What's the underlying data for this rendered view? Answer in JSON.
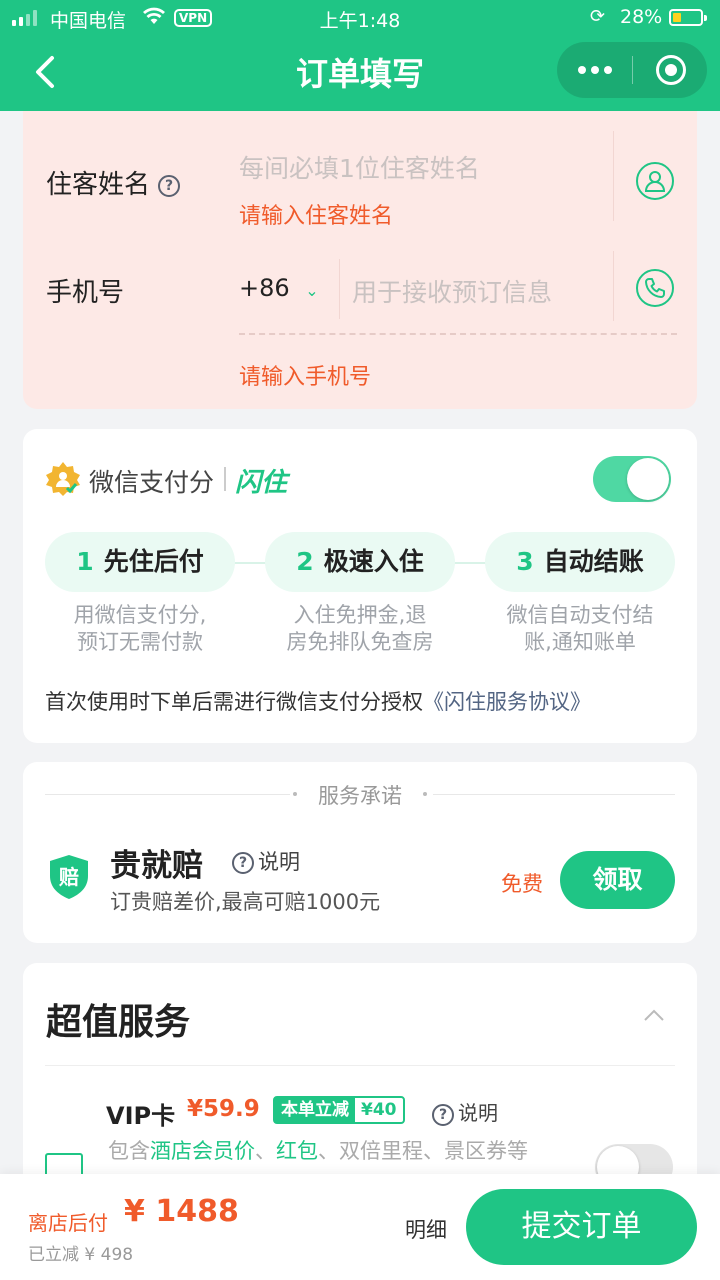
{
  "status_bar": {
    "carrier": "中国电信",
    "vpn": "VPN",
    "time": "上午1:48",
    "battery": "28%"
  },
  "header": {
    "title": "订单填写"
  },
  "guest_form": {
    "name_label": "住客姓名",
    "name_placeholder": "每间必填1位住客姓名",
    "name_error": "请输入住客姓名",
    "phone_label": "手机号",
    "country_code": "+86",
    "phone_placeholder": "用于接收预订信息",
    "phone_error": "请输入手机号"
  },
  "wechat_pay": {
    "brand": "微信支付分",
    "product": "闪住",
    "toggle_on": true,
    "steps": [
      {
        "num": "1",
        "label": "先住后付",
        "desc1": "用微信支付分,",
        "desc2": "预订无需付款"
      },
      {
        "num": "2",
        "label": "极速入住",
        "desc1": "入住免押金,退",
        "desc2": "房免排队免查房"
      },
      {
        "num": "3",
        "label": "自动结账",
        "desc1": "微信自动支付结",
        "desc2": "账,通知账单"
      }
    ],
    "note": "首次使用时下单后需进行微信支付分授权",
    "agreement_link": "《闪住服务协议》"
  },
  "service_promise": {
    "title": "服务承诺",
    "shield_char": "赔",
    "name": "贵就赔",
    "explain": "说明",
    "desc": "订贵赔差价,最高可赔1000元",
    "price_tag": "免费",
    "claim_button": "领取"
  },
  "value_services": {
    "title": "超值服务",
    "vip_name": "VIP卡",
    "vip_price": "¥59.9",
    "badge_label": "本单立减",
    "badge_amount": "¥40",
    "explain": "说明",
    "desc_prefix": "包含",
    "desc_h1": "酒店会员价",
    "desc_sep1": "、",
    "desc_h2": "红包",
    "desc_rest": "、双倍里程、景区券等"
  },
  "bottom_bar": {
    "pay_label": "离店后付",
    "price": "¥ 1488",
    "saved": "已立减 ¥ 498",
    "detail_button": "明细",
    "submit_button": "提交订单"
  },
  "colors": {
    "brand_green": "#1fc585",
    "error_orange": "#f05b2b",
    "error_bg": "#fde9e6"
  }
}
